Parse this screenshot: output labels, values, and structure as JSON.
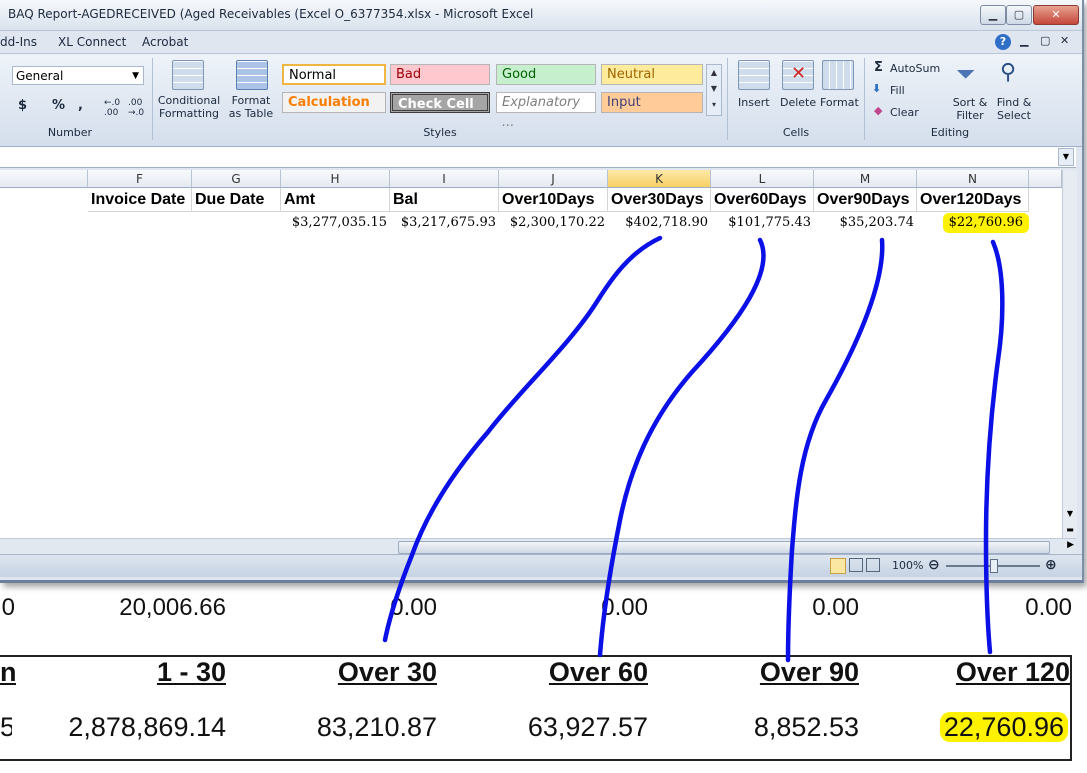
{
  "window": {
    "title": "BAQ Report-AGEDRECEIVED (Aged Receivables (Excel O_6377354.xlsx  -  Microsoft Excel",
    "controls": [
      "▁",
      "▢",
      "✕"
    ]
  },
  "ribbon_tabs": [
    "dd-Ins",
    "XL Connect",
    "Acrobat"
  ],
  "ribbon": {
    "number_format": "General",
    "number_symbols": [
      "$",
      "%",
      ","
    ],
    "number_group": "Number",
    "conditional_formatting": "Conditional Formatting",
    "format_as_table": "Format as Table",
    "styles_group": "Styles",
    "styles": [
      {
        "label": "Normal",
        "bg": "#ffffff",
        "fg": "#000000"
      },
      {
        "label": "Bad",
        "bg": "#ffc7ce",
        "fg": "#9c0006"
      },
      {
        "label": "Good",
        "bg": "#c6efce",
        "fg": "#006100"
      },
      {
        "label": "Neutral",
        "bg": "#ffeb9c",
        "fg": "#9c6500"
      },
      {
        "label": "Calculation",
        "bg": "#f2f2f2",
        "fg": "#fa7d00"
      },
      {
        "label": "Check Cell",
        "bg": "#a5a5a5",
        "fg": "#ffffff"
      },
      {
        "label": "Explanatory ...",
        "bg": "#ffffff",
        "fg": "#7f7f7f"
      },
      {
        "label": "Input",
        "bg": "#ffcc99",
        "fg": "#3f3f76"
      }
    ],
    "insert": "Insert",
    "delete": "Delete",
    "format": "Format",
    "cells_group": "Cells",
    "autosum": "AutoSum",
    "fill": "Fill",
    "clear": "Clear",
    "sort_filter": "Sort & Filter",
    "find_select": "Find & Select",
    "editing_group": "Editing"
  },
  "columns": [
    "F",
    "G",
    "H",
    "I",
    "J",
    "K",
    "L",
    "M",
    "N"
  ],
  "selected_column": "K",
  "headers": [
    "Invoice Date",
    "Due Date",
    "Amt",
    "Bal",
    "Over10Days",
    "Over30Days",
    "Over60Days",
    "Over90Days",
    "Over120Days"
  ],
  "values": [
    "",
    "",
    "$3,277,035.15",
    "$3,217,675.93",
    "$2,300,170.22",
    "$402,718.90",
    "$101,775.43",
    "$35,203.74",
    "$22,760.96"
  ],
  "highlight_color": "#fff200",
  "ink_color": "#0a10e6",
  "status": {
    "zoom": "100%"
  },
  "report": {
    "row1": [
      "0",
      "20,006.66",
      "0.00",
      "0.00",
      "0.00",
      "0.00"
    ],
    "headers": [
      "nt",
      "1 - 30",
      "Over 30",
      "Over 60",
      "Over 90",
      "Over 120"
    ],
    "values": [
      "5",
      "2,878,869.14",
      "83,210.87",
      "63,927.57",
      "8,852.53",
      "22,760.96"
    ]
  }
}
